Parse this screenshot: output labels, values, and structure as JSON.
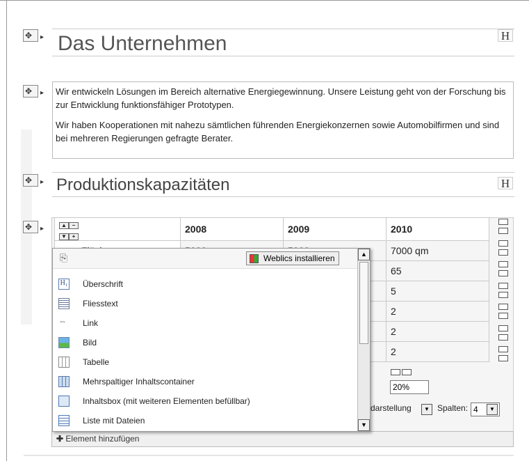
{
  "heading1": "Das Unternehmen",
  "paragraphs": [
    "Wir entwickeln Lösungen im Bereich alternative Energiegewinnung. Unsere Leistung geht von der Forschung bis zur Entwicklung funktionsfähiger Prototypen.",
    "Wir haben Kooperationen mit nahezu sämtlichen führenden Energiekonzernen sowie Automobilfirmen und sind bei mehreren Regierungen gefragte Berater."
  ],
  "heading2": "Produktionskapazitäten",
  "heading_icon_label": "H",
  "table": {
    "headers": [
      "",
      "2008",
      "2009",
      "2010"
    ],
    "first_row": [
      "Fläche",
      "5000 qm",
      "5000 qm",
      "7000 qm"
    ],
    "col2010_values": [
      "65",
      "5",
      "2",
      "2",
      "2"
    ]
  },
  "table_options": {
    "width_value": "20%",
    "darstellung_label": "darstellung",
    "spalten_label": "Spalten:",
    "spalten_value": "4"
  },
  "add_element_label": "Element hinzufügen",
  "popup": {
    "weblics_button": "Weblics installieren",
    "items": [
      {
        "label": "Überschrift",
        "icon": "heading-icon"
      },
      {
        "label": "Fliesstext",
        "icon": "text-icon"
      },
      {
        "label": "Link",
        "icon": "link-icon"
      },
      {
        "label": "Bild",
        "icon": "image-icon"
      },
      {
        "label": "Tabelle",
        "icon": "table-icon"
      },
      {
        "label": "Mehrspaltiger Inhaltscontainer",
        "icon": "columns-icon"
      },
      {
        "label": "Inhaltsbox (mit weiteren Elementen befüllbar)",
        "icon": "box-icon"
      },
      {
        "label": "Liste mit Dateien",
        "icon": "file-list-icon"
      }
    ]
  }
}
